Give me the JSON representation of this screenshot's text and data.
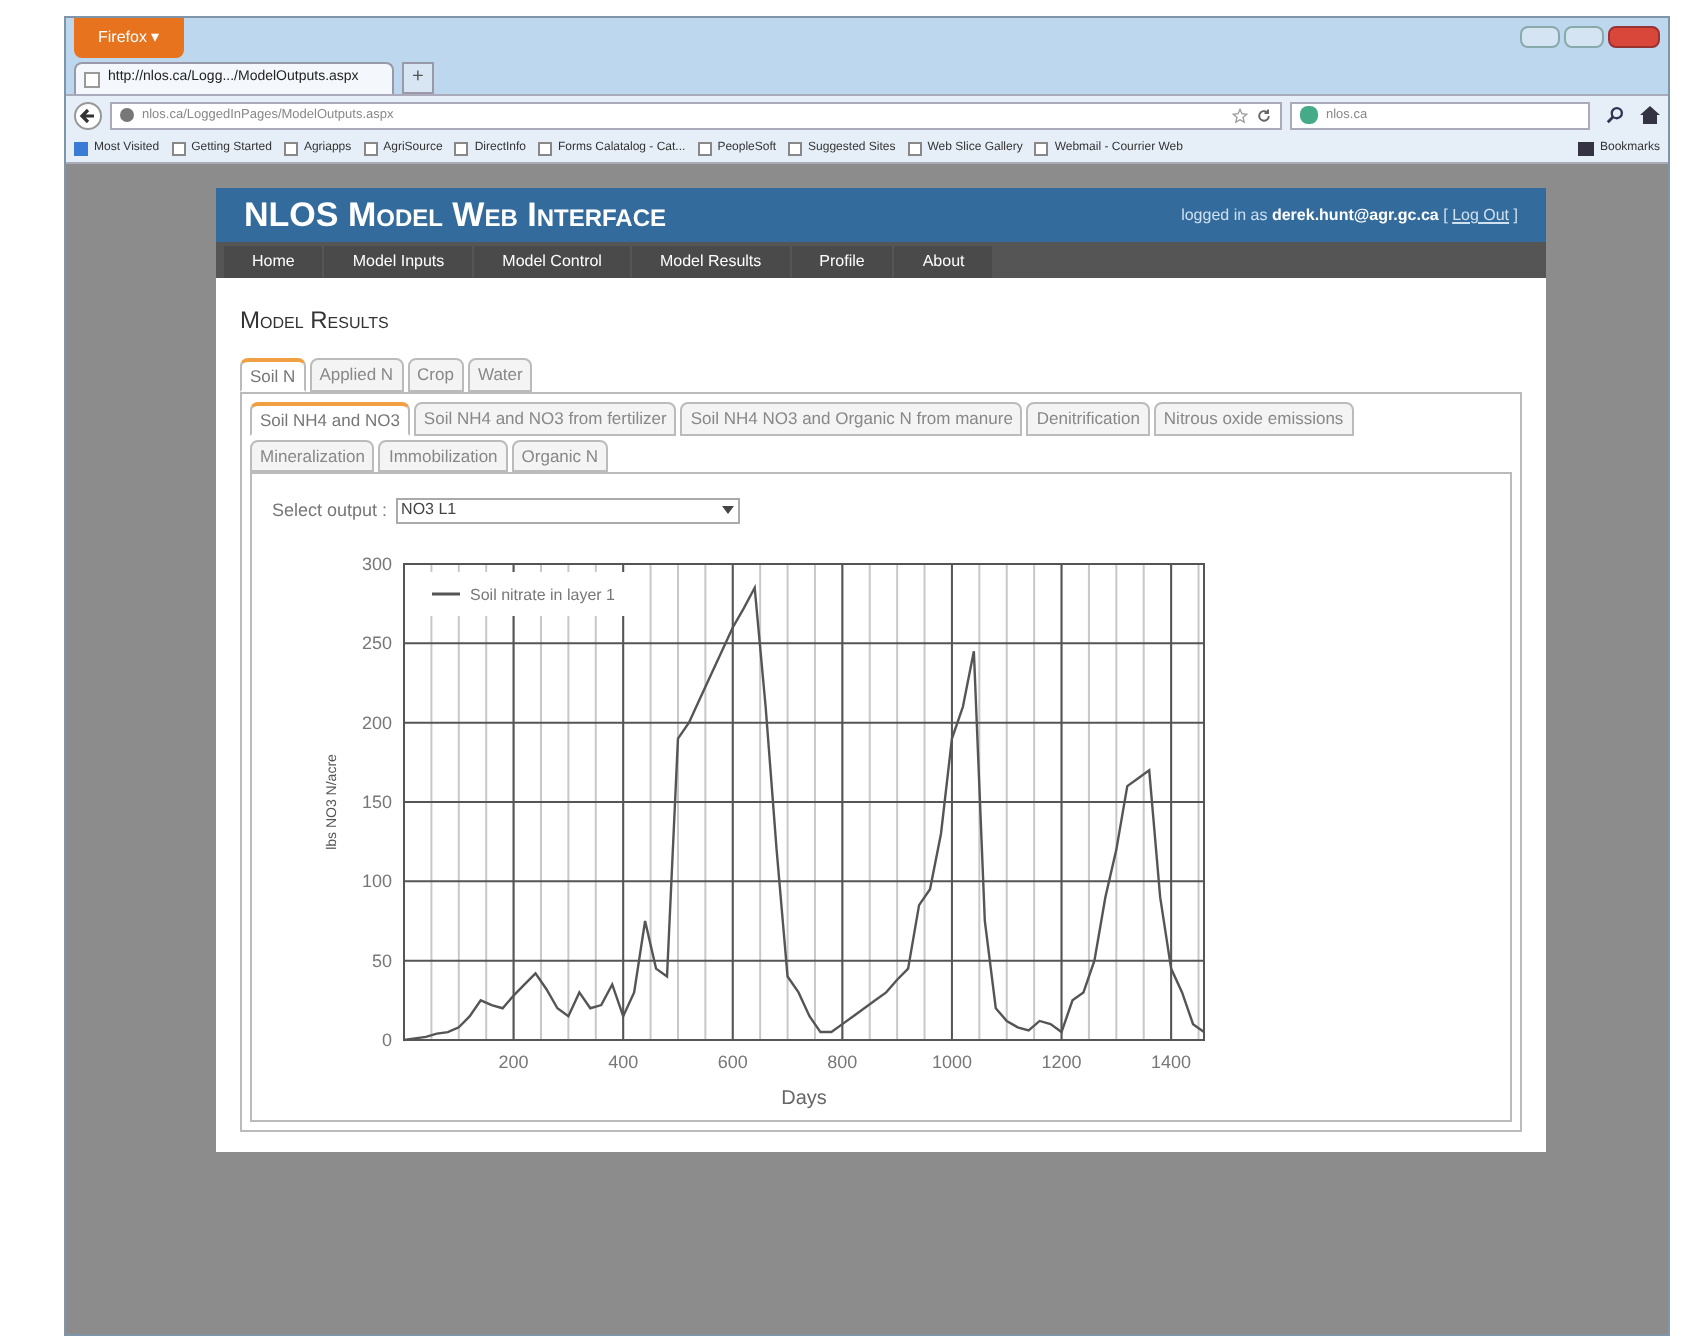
{
  "browser": {
    "menu_button": "Firefox ▾",
    "tab": {
      "title": "http://nlos.ca/Logg.../ModelOutputs.aspx",
      "new_tab": "+"
    },
    "address": "nlos.ca/LoggedInPages/ModelOutputs.aspx",
    "search": "nlos.ca",
    "bookmarks": [
      {
        "label": "Most Visited",
        "kind": "special"
      },
      {
        "label": "Getting Started",
        "kind": "page"
      },
      {
        "label": "Agriapps",
        "kind": "page"
      },
      {
        "label": "AgriSource",
        "kind": "page"
      },
      {
        "label": "DirectInfo",
        "kind": "page"
      },
      {
        "label": "Forms Calatalog - Cat...",
        "kind": "page"
      },
      {
        "label": "PeopleSoft",
        "kind": "page"
      },
      {
        "label": "Suggested Sites",
        "kind": "page"
      },
      {
        "label": "Web Slice Gallery",
        "kind": "page"
      },
      {
        "label": "Webmail - Courrier Web",
        "kind": "page"
      }
    ],
    "bookmarks_menu": "Bookmarks"
  },
  "site": {
    "title": "NLOS Model Web Interface",
    "login": {
      "prefix": "logged in as",
      "user": "derek.hunt@agr.gc.ca",
      "open": "[",
      "link": "Log Out",
      "close": "]"
    },
    "nav": [
      {
        "label": "Home"
      },
      {
        "label": "Model Inputs"
      },
      {
        "label": "Model Control"
      },
      {
        "label": "Model Results"
      },
      {
        "label": "Profile"
      },
      {
        "label": "About"
      }
    ]
  },
  "page_title": "Model Results",
  "tabs": [
    {
      "label": "Soil N",
      "selected": true
    },
    {
      "label": "Applied N",
      "selected": false
    },
    {
      "label": "Crop",
      "selected": false
    },
    {
      "label": "Water",
      "selected": false
    }
  ],
  "subtabs": [
    {
      "label": "Soil NH4 and NO3",
      "selected": true
    },
    {
      "label": "Soil NH4 and NO3 from fertilizer",
      "selected": false
    },
    {
      "label": "Soil NH4 NO3 and Organic N from manure",
      "selected": false
    },
    {
      "label": "Denitrification",
      "selected": false
    },
    {
      "label": "Nitrous oxide emissions",
      "selected": false
    },
    {
      "label": "Mineralization",
      "selected": false
    },
    {
      "label": "Immobilization",
      "selected": false
    },
    {
      "label": "Organic N",
      "selected": false
    }
  ],
  "select_output": {
    "label": "Select output :",
    "value": "NO3 L1"
  },
  "chart_data": {
    "type": "line",
    "grid": true,
    "xlabel": "Days",
    "ylabel": "lbs NO3 N/acre",
    "xlim": [
      0,
      1460
    ],
    "ylim": [
      0,
      300
    ],
    "xticks": [
      200,
      400,
      600,
      800,
      1000,
      1200,
      1400
    ],
    "yticks": [
      0,
      50,
      100,
      150,
      200,
      250,
      300
    ],
    "x": [
      0,
      20,
      40,
      60,
      80,
      100,
      120,
      140,
      160,
      180,
      200,
      220,
      240,
      260,
      280,
      300,
      320,
      340,
      360,
      380,
      400,
      420,
      440,
      460,
      480,
      500,
      520,
      540,
      560,
      580,
      600,
      620,
      640,
      660,
      680,
      700,
      720,
      740,
      760,
      780,
      800,
      820,
      840,
      860,
      880,
      900,
      920,
      940,
      960,
      980,
      1000,
      1020,
      1040,
      1060,
      1080,
      1100,
      1120,
      1140,
      1160,
      1180,
      1200,
      1220,
      1240,
      1260,
      1280,
      1300,
      1320,
      1340,
      1360,
      1380,
      1400,
      1420,
      1440,
      1460
    ],
    "series": [
      {
        "name": "Soil nitrate in layer 1",
        "color": "#555555",
        "values": [
          0,
          1,
          2,
          4,
          5,
          8,
          15,
          25,
          22,
          20,
          28,
          35,
          42,
          32,
          20,
          15,
          30,
          20,
          22,
          35,
          15,
          30,
          75,
          45,
          40,
          190,
          200,
          215,
          230,
          245,
          260,
          272,
          285,
          210,
          120,
          40,
          30,
          15,
          5,
          5,
          10,
          15,
          20,
          25,
          30,
          38,
          45,
          85,
          95,
          130,
          190,
          210,
          245,
          75,
          20,
          12,
          8,
          6,
          12,
          10,
          5,
          25,
          30,
          50,
          90,
          120,
          160,
          165,
          170,
          90,
          45,
          30,
          10,
          5
        ]
      }
    ]
  }
}
